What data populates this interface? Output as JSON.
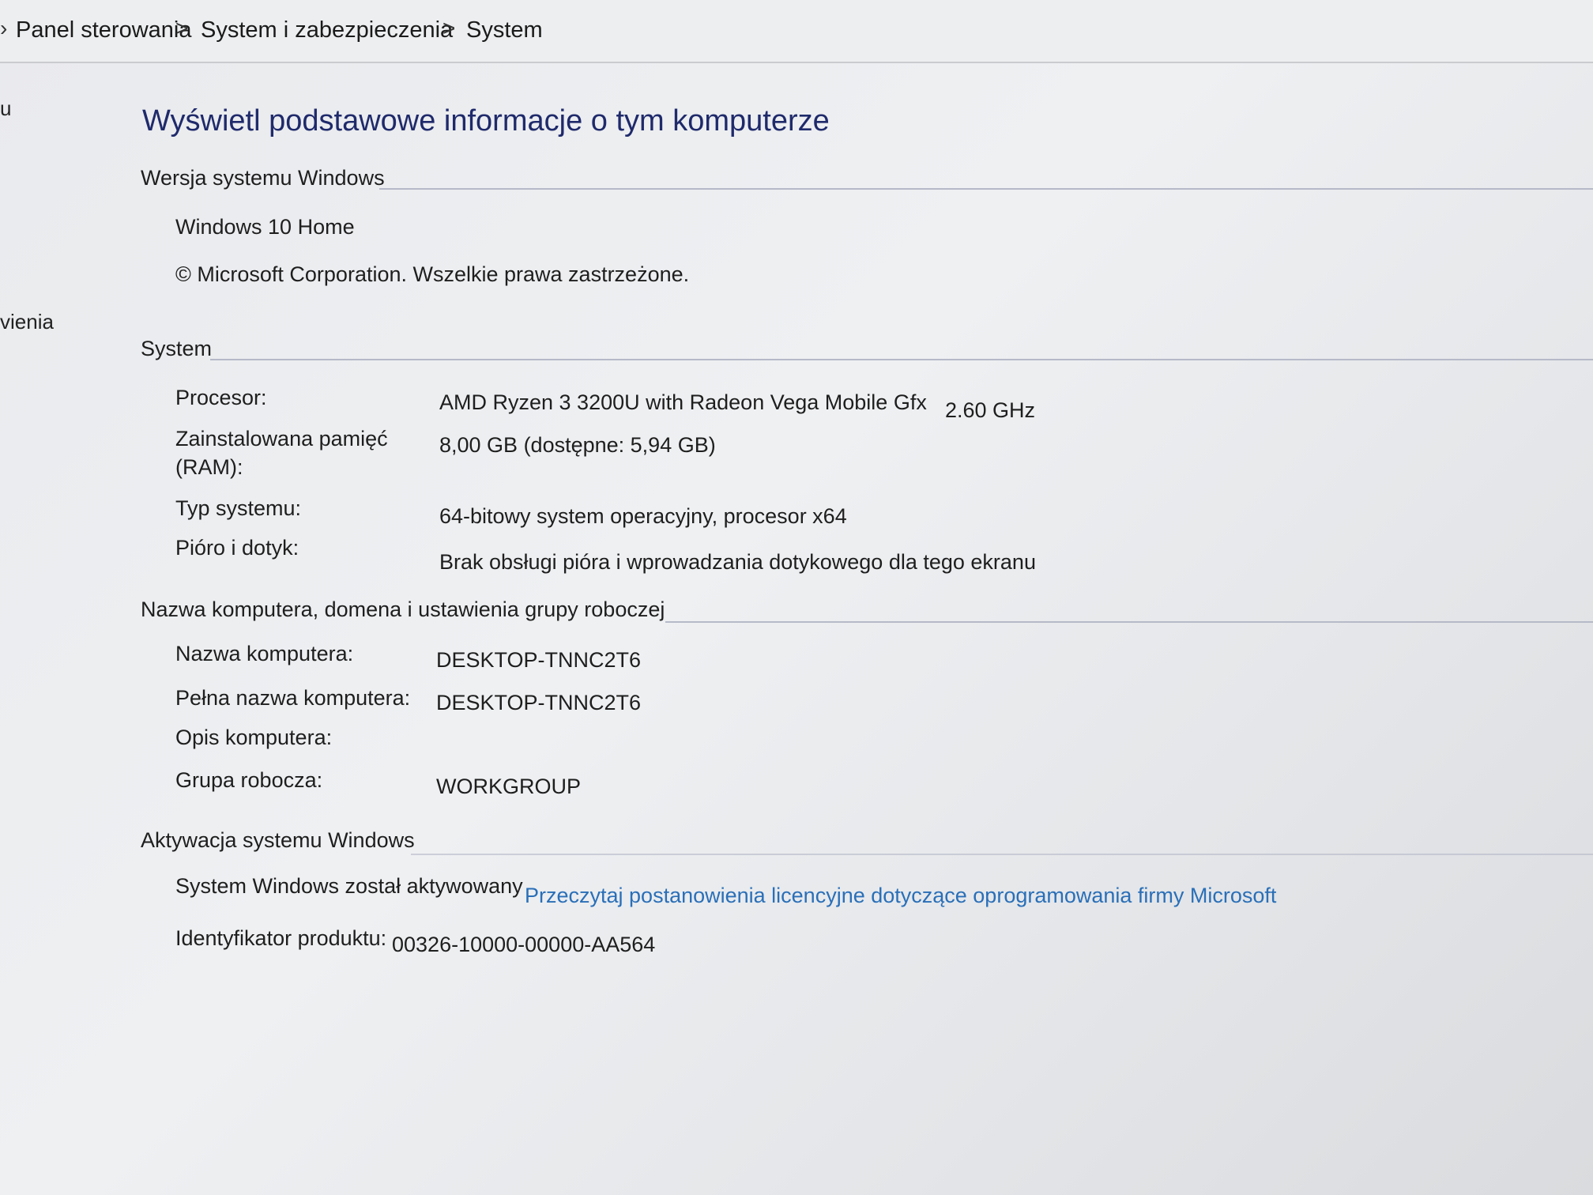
{
  "breadcrumb": {
    "items": [
      "Panel sterowania",
      "System i zabezpieczenia",
      "System"
    ],
    "separator": ">"
  },
  "sidebar_fragments": [
    "u",
    "vienia"
  ],
  "page_title": "Wyświetl podstawowe informacje o tym komputerze",
  "windows_edition": {
    "header": "Wersja systemu Windows",
    "edition": "Windows 10 Home",
    "copyright": "© Microsoft Corporation. Wszelkie prawa zastrzeżone."
  },
  "system": {
    "header": "System",
    "processor_label": "Procesor:",
    "processor_value": "AMD Ryzen 3 3200U with Radeon Vega Mobile Gfx",
    "processor_speed": "2.60 GHz",
    "ram_label_line1": "Zainstalowana pamięć",
    "ram_label_line2": "(RAM):",
    "ram_value": "8,00 GB (dostępne: 5,94 GB)",
    "type_label": "Typ systemu:",
    "type_value": "64-bitowy system operacyjny, procesor x64",
    "pen_label": "Pióro i dotyk:",
    "pen_value": "Brak obsługi pióra i wprowadzania dotykowego dla tego ekranu"
  },
  "computer_name": {
    "header": "Nazwa komputera, domena i ustawienia grupy roboczej",
    "name_label": "Nazwa komputera:",
    "name_value": "DESKTOP-TNNC2T6",
    "full_name_label": "Pełna nazwa komputera:",
    "full_name_value": "DESKTOP-TNNC2T6",
    "description_label": "Opis komputera:",
    "workgroup_label": "Grupa robocza:",
    "workgroup_value": "WORKGROUP"
  },
  "activation": {
    "header": "Aktywacja systemu Windows",
    "status": "System Windows został aktywowany",
    "license_link": "Przeczytaj postanowienia licencyjne dotyczące oprogramowania firmy Microsoft",
    "product_id_label": "Identyfikator produktu:",
    "product_id_value": "00326-10000-00000-AA564"
  },
  "colors": {
    "title": "#1f2a6b",
    "link": "#2a6fb8",
    "divider": "#b6b9c8"
  }
}
